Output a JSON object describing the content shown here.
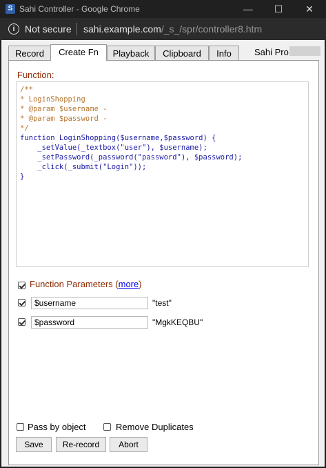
{
  "window": {
    "title": "Sahi Controller - Google Chrome",
    "controls": {
      "minimize": "—",
      "maximize": "☐",
      "close": "✕"
    }
  },
  "address": {
    "security_label": "Not secure",
    "host": "sahi.example.com",
    "path": "/_s_/spr/controller8.htm"
  },
  "tabs": [
    {
      "label": "Record",
      "active": false
    },
    {
      "label": "Create Fn",
      "active": true
    },
    {
      "label": "Playback",
      "active": false
    },
    {
      "label": "Clipboard",
      "active": false
    },
    {
      "label": "Info",
      "active": false
    }
  ],
  "brand": "Sahi Pro",
  "function_label": "Function:",
  "code": {
    "lines": [
      "/**",
      "* LoginShopping",
      "* @param $username -",
      "* @param $password -",
      "*/",
      "function LoginShopping($username,$password) {",
      "    _setValue(_textbox(\"user\"), $username);",
      "    _setPassword(_password(\"password\"), $password);",
      "    _click(_submit(\"Login\"));",
      "}"
    ]
  },
  "function_parameters": {
    "label": "Function Parameters",
    "more_link": "more",
    "checked": true,
    "params": [
      {
        "name": "$username",
        "value": "\"test\"",
        "checked": true
      },
      {
        "name": "$password",
        "value": "\"MgkKEQBU\"",
        "checked": true
      }
    ]
  },
  "options": {
    "pass_by_object": "Pass by object",
    "remove_duplicates": "Remove Duplicates"
  },
  "buttons": {
    "save": "Save",
    "rerecord": "Re-record",
    "abort": "Abort"
  }
}
